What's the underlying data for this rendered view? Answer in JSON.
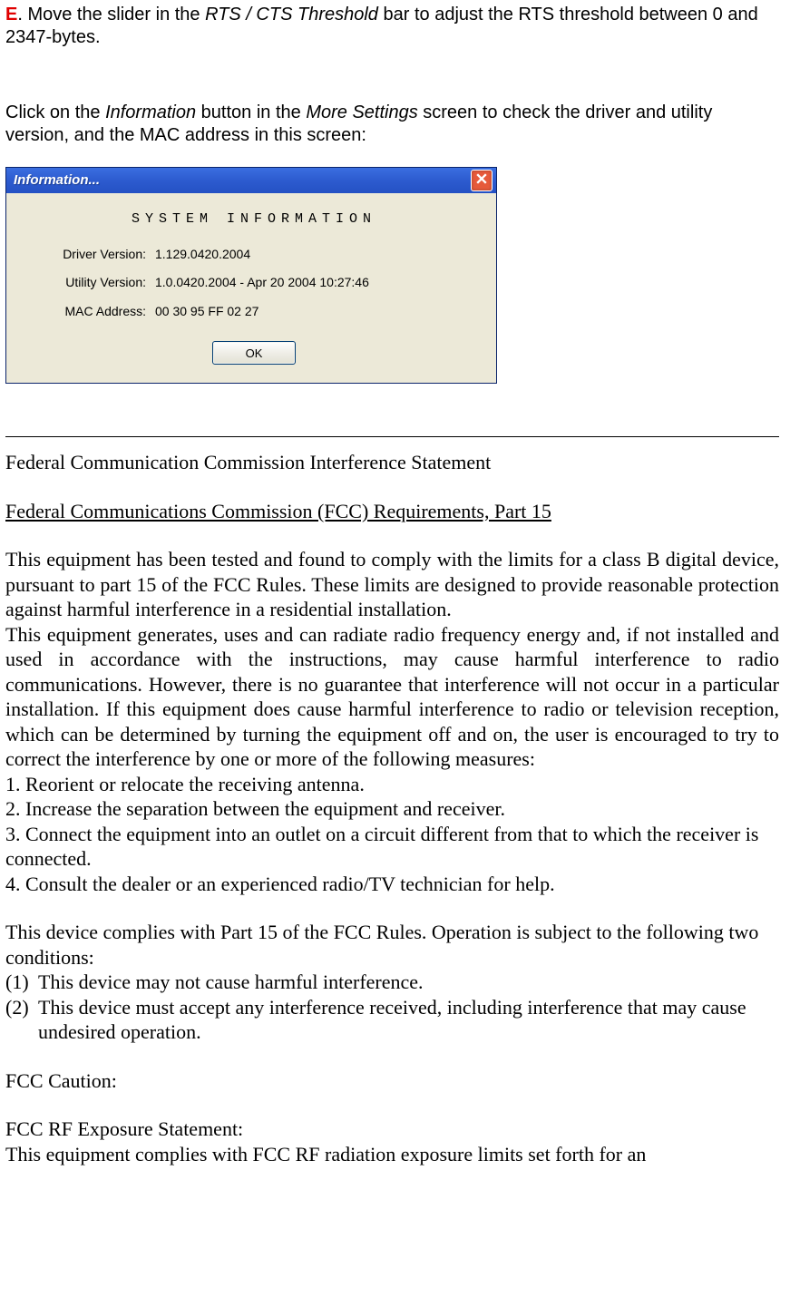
{
  "para1": {
    "marker": "E",
    "pre": ". Move the slider in the ",
    "ital1": "RTS / CTS Threshold",
    "post": " bar to adjust the RTS threshold between 0 and 2347-bytes."
  },
  "para2": {
    "pre": "Click on the ",
    "ital1": "Information",
    "mid": " button in the ",
    "ital2": "More Settings",
    "post": " screen to check the driver and utility version, and the MAC address in this screen:"
  },
  "dialog": {
    "title": "Information...",
    "heading": "SYSTEM INFORMATION",
    "rows": {
      "driver": {
        "label": "Driver Version:",
        "value": "1.129.0420.2004"
      },
      "utility": {
        "label": "Utility Version:",
        "value": "1.0.0420.2004 - Apr 20 2004 10:27:46"
      },
      "mac": {
        "label": "MAC Address:",
        "value": "00 30 95 FF 02 27"
      }
    },
    "ok": "OK"
  },
  "fcc": {
    "h1": "Federal Communication Commission Interference Statement",
    "h2": "Federal Communications Commission (FCC) Requirements, Part 15",
    "body1": "This equipment has been tested and found to comply with the limits for a class B digital device, pursuant to part 15 of the FCC Rules. These limits are designed to provide reasonable protection against harmful interference in a residential installation.",
    "body2": "This equipment generates, uses and can radiate radio frequency energy and, if not installed and used in accordance with the instructions, may cause harmful interference to radio communications. However, there is no guarantee that interference will not occur in a particular installation. If this equipment does cause harmful interference to radio or television reception, which can be determined by turning the equipment off and on, the user is encouraged to try to correct the interference by one or more of the following measures:",
    "m1": "1. Reorient or relocate the receiving antenna.",
    "m2": "2. Increase the separation between the equipment and receiver.",
    "m3": "3. Connect the equipment into an outlet on a circuit different from that to which the receiver is connected.",
    "m4": "4. Consult the dealer or an experienced radio/TV technician for help.",
    "part15": "This device complies with Part 15 of the FCC Rules. Operation is subject to the following two conditions:",
    "c1_num": "(1)",
    "c1_txt": "This device may not cause harmful interference.",
    "c2_num": "(2)",
    "c2_txt": "This device must accept any interference received, including interference that may cause undesired operation.",
    "caution": "FCC Caution:",
    "rf_title": "FCC RF Exposure Statement:",
    "rf_body": "This equipment complies with FCC RF radiation exposure limits set forth for an"
  }
}
